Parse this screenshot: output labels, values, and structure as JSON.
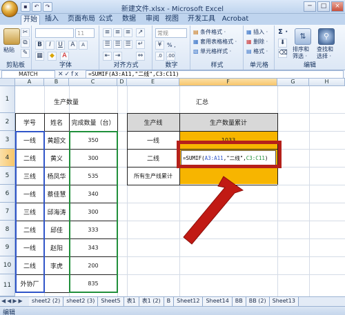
{
  "window": {
    "title": "新建文件.xlsx - Microsoft Excel",
    "minimize": "─",
    "maximize": "□",
    "close": "×"
  },
  "ribbon_tabs": [
    "开始",
    "插入",
    "页面布局",
    "公式",
    "数据",
    "审阅",
    "视图",
    "开发工具",
    "Acrobat"
  ],
  "ribbon": {
    "clipboard": {
      "label": "剪贴板",
      "paste": "粘贴"
    },
    "font": {
      "label": "字体",
      "size": "11"
    },
    "alignment": {
      "label": "对齐方式"
    },
    "number": {
      "label": "数字",
      "format": "常规",
      "pct": "% ,"
    },
    "styles": {
      "label": "样式",
      "items": [
        "条件格式 ·",
        "套用表格格式 ·",
        "单元格样式 ·"
      ]
    },
    "cells": {
      "label": "单元格",
      "items": [
        "插入 ·",
        "删除 ·",
        "格式 ·"
      ]
    },
    "editing": {
      "label": "编辑",
      "sort": "排序和\n筛选 ·",
      "find": "查找和\n选择 ·",
      "sigma": "Σ ·"
    }
  },
  "formula_bar": {
    "name_box": "MATCH",
    "formula": "=SUMIF(A3:A11,\"二线\",C3:C11)"
  },
  "columns": [
    "A",
    "B",
    "C",
    "D",
    "E",
    "F",
    "G",
    "H"
  ],
  "rows": [
    "1",
    "2",
    "3",
    "4",
    "5",
    "6",
    "7",
    "8",
    "9",
    "10",
    "11"
  ],
  "left_table": {
    "title": "生产数量",
    "headers": [
      "学号",
      "姓名",
      "完成数量（台）"
    ],
    "rows": [
      [
        "一线",
        "黄超文",
        "350"
      ],
      [
        "二线",
        "黄义",
        "300"
      ],
      [
        "三线",
        "杨凤华",
        "535"
      ],
      [
        "一线",
        "蔡佳慧",
        "340"
      ],
      [
        "三线",
        "邱海涛",
        "300"
      ],
      [
        "二线",
        "邱佳",
        "333"
      ],
      [
        "一线",
        "赵阳",
        "343"
      ],
      [
        "二线",
        "李虎",
        "200"
      ],
      [
        "外协厂",
        "",
        "835"
      ]
    ]
  },
  "right_table": {
    "title": "汇总",
    "headers": [
      "生产线",
      "生产数量累计"
    ],
    "rows": [
      {
        "label": "一线",
        "value": "1033"
      },
      {
        "label": "二线",
        "value": "=SUMIF(A3:A11,\"二线\",C3:C11)"
      },
      {
        "label": "所有生产线累计",
        "value": ""
      }
    ]
  },
  "sheet_tabs": [
    "sheet2 (2)",
    "sheet2 (3)",
    "Sheet5",
    "表1",
    "表1 (2)",
    "B",
    "Sheet12",
    "Sheet14",
    "BB",
    "BB (2)",
    "Sheet13"
  ],
  "status": {
    "mode": "编辑"
  },
  "colors": {
    "formula_fill": "#f7b500",
    "highlight_red": "#b5201a",
    "range_blue": "#2f54c8",
    "range_green": "#1f8f3a"
  }
}
